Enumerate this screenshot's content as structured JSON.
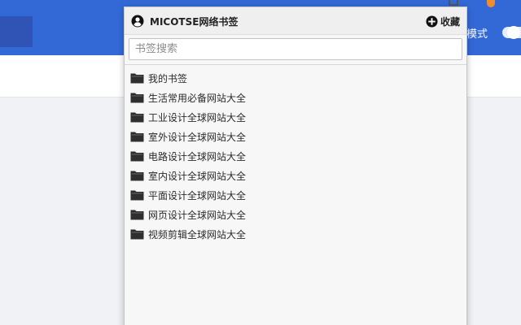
{
  "background": {
    "mode_label": "模式"
  },
  "popup": {
    "title": "MICOTSE网络书签",
    "add_label": "收藏",
    "search": {
      "placeholder": "书签搜索",
      "value": ""
    },
    "folders": [
      {
        "label": "我的书签"
      },
      {
        "label": "生活常用必备网站大全"
      },
      {
        "label": "工业设计全球网站大全"
      },
      {
        "label": "室外设计全球网站大全"
      },
      {
        "label": "电路设计全球网站大全"
      },
      {
        "label": "室内设计全球网站大全"
      },
      {
        "label": "平面设计全球网站大全"
      },
      {
        "label": "网页设计全球网站大全"
      },
      {
        "label": "视频剪辑全球网站大全"
      }
    ]
  },
  "colors": {
    "header_blue": "#3369d6",
    "folder_icon": "#2f2f2f",
    "popup_bg": "#f7f7f7"
  },
  "icons": {
    "account": "user-circle-icon",
    "add": "plus-circle-icon",
    "folder": "folder-icon"
  }
}
